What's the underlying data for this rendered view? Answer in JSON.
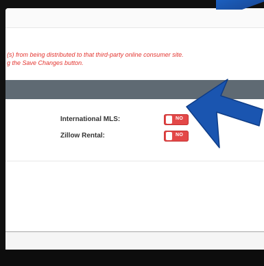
{
  "notice": {
    "line1": "(s) from being distributed to that third-party online consumer site.",
    "line2": "g the Save Changes button."
  },
  "options": [
    {
      "label": "International MLS:",
      "toggle_text": "NO"
    },
    {
      "label": "Zillow Rental:",
      "toggle_text": "NO"
    }
  ],
  "colors": {
    "notice_text": "#e3342f",
    "header_bar": "#5f6a73",
    "toggle_off": "#e34848",
    "arrow": "#1a55b0"
  },
  "icons": {
    "pointer": "arrow-pointer-icon"
  }
}
